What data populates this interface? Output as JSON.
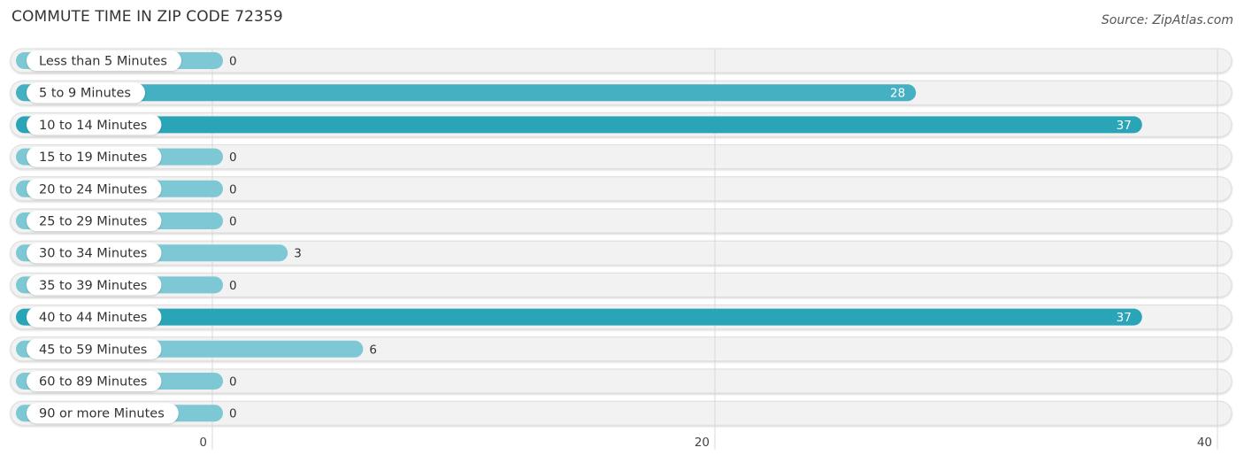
{
  "header": {
    "title": "COMMUTE TIME IN ZIP CODE 72359",
    "source": "Source: ZipAtlas.com"
  },
  "colors": {
    "bar_high": "#2aa5b8",
    "bar_mid": "#44b0c2",
    "bar_low": "#7dc8d4",
    "track": "#f2f2f2",
    "grid": "#d8d8d8"
  },
  "chart_data": {
    "type": "bar",
    "orientation": "horizontal",
    "title": "COMMUTE TIME IN ZIP CODE 72359",
    "xlabel": "",
    "ylabel": "",
    "xlim": [
      0,
      40
    ],
    "xticks": [
      0,
      20,
      40
    ],
    "grid": true,
    "categories": [
      "Less than 5 Minutes",
      "5 to 9 Minutes",
      "10 to 14 Minutes",
      "15 to 19 Minutes",
      "20 to 24 Minutes",
      "25 to 29 Minutes",
      "30 to 34 Minutes",
      "35 to 39 Minutes",
      "40 to 44 Minutes",
      "45 to 59 Minutes",
      "60 to 89 Minutes",
      "90 or more Minutes"
    ],
    "values": [
      0,
      28,
      37,
      0,
      0,
      0,
      3,
      0,
      37,
      6,
      0,
      0
    ]
  }
}
